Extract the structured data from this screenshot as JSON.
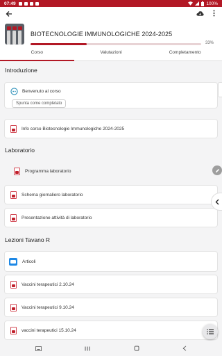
{
  "status_bar": {
    "time": "07:49",
    "battery": "100%"
  },
  "course": {
    "title": "BIOTECNOLOGIE IMMUNOLOGICHE 2024-2025",
    "progress_percent": 33,
    "progress_label": "33%"
  },
  "tabs": [
    {
      "label": "Corso",
      "active": true
    },
    {
      "label": "Valutazioni",
      "active": false
    },
    {
      "label": "Completamento",
      "active": false
    }
  ],
  "sections": [
    {
      "title": "Introduzione",
      "items": [
        {
          "label": "Benvenuto al corso",
          "icon": "forum-icon",
          "button": "Spunta come completato"
        },
        {
          "label": "Info corso Biotecnologie Immunologiche 2024-2025",
          "icon": "pdf-icon"
        }
      ]
    },
    {
      "title": "Laboratorio",
      "items": [
        {
          "label": "Programma laboratorio",
          "icon": "pdf-icon"
        },
        {
          "label": "Schema giornaliero laboratorio",
          "icon": "pdf-icon"
        },
        {
          "label": "Presentazione attività di laboratorio",
          "icon": "pdf-icon"
        }
      ]
    },
    {
      "title": "Lezioni Tavano R",
      "items": [
        {
          "label": "Articoli",
          "icon": "folder-icon"
        },
        {
          "label": "Vaccini terapeutici 2.10.24",
          "icon": "pdf-icon"
        },
        {
          "label": "Vaccini terapeutici 9.10.24",
          "icon": "pdf-icon"
        },
        {
          "label": "vaccini terapeutici 15.10.24",
          "icon": "pdf-icon"
        }
      ]
    }
  ],
  "colors": {
    "accent": "#b21825",
    "folder": "#1e88e5",
    "background": "#f4f4f5"
  }
}
